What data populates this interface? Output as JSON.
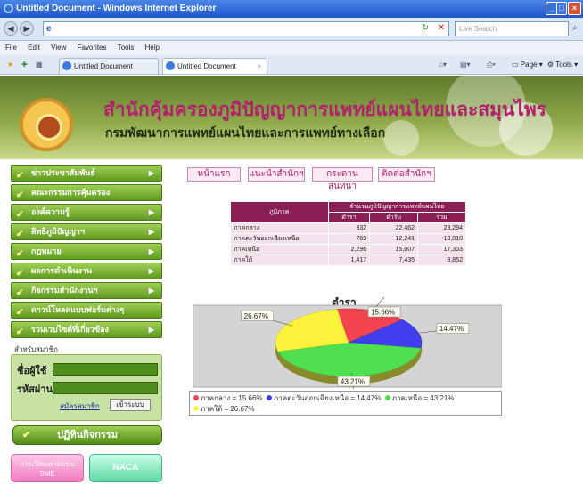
{
  "window": {
    "title": "Untitled Document - Windows Internet Explorer",
    "min": "_",
    "max": "□",
    "close": "×"
  },
  "address": {
    "url": "",
    "search_placeholder": "Live Search"
  },
  "menu": {
    "items": [
      "File",
      "Edit",
      "View",
      "Favorites",
      "Tools",
      "Help"
    ]
  },
  "tabs": [
    {
      "label": "Untitled Document"
    },
    {
      "label": "Untitled Document"
    }
  ],
  "tools": {
    "page": "Page",
    "tools": "Tools"
  },
  "banner": {
    "title": "สำนักคุ้มครองภูมิปัญญาการแพทย์แผนไทยและสมุนไพร",
    "subtitle": "กรมพัฒนาการแพทย์แผนไทยและการแพทย์ทางเลือก"
  },
  "sidebar": {
    "items": [
      {
        "label": "ข่าวประชาสัมพันธ์",
        "arrow": true
      },
      {
        "label": "คณะกรรมการคุ้มครอง",
        "arrow": false
      },
      {
        "label": "องค์ความรู้",
        "arrow": true
      },
      {
        "label": "สิทธิภูมิปัญญาฯ",
        "arrow": true
      },
      {
        "label": "กฎหมาย",
        "arrow": true
      },
      {
        "label": "ผลการดำเนินงาน",
        "arrow": true
      },
      {
        "label": "กิจกรรมสำนักงานฯ",
        "arrow": true
      },
      {
        "label": "ดาวน์โหลดแบบฟอร์มต่างๆ",
        "arrow": false
      },
      {
        "label": "รวมเวบไซต์ที่เกี่ยวข้อง",
        "arrow": true
      }
    ]
  },
  "login": {
    "section_label": "สำหรับสมาชิก",
    "user_label": "ชื่อผู้ใช้",
    "pass_label": "รหัสผ่าน",
    "register": "สมัครสมาชิก",
    "login_btn": "เข้าระบบ"
  },
  "calendar_button": "ปฏิทินกิจกรรม",
  "promo": {
    "pink": "การเปิดตลาดแบบ SME",
    "green": "NACA"
  },
  "nav": {
    "items": [
      "หน้าแรก",
      "แนะนำสำนักฯ",
      "กระดานสนทนา",
      "ติดต่อสำนักฯ"
    ]
  },
  "table": {
    "header_region": "ภูมิภาค",
    "header_group": "จำนวนภูมิปัญญาการแพทย์แผนไทย",
    "columns": [
      "ตำรา",
      "ตำรับ",
      "รวม"
    ],
    "rows": [
      {
        "region": "ภาคกลาง",
        "a": "832",
        "b": "22,462",
        "c": "23,294"
      },
      {
        "region": "ภาคตะวันออกเฉียงเหนือ",
        "a": "769",
        "b": "12,241",
        "c": "13,010"
      },
      {
        "region": "ภาคเหนือ",
        "a": "2,296",
        "b": "15,007",
        "c": "17,303"
      },
      {
        "region": "ภาคใต้",
        "a": "1,417",
        "b": "7,435",
        "c": "8,852"
      }
    ]
  },
  "chart_data": {
    "type": "pie",
    "title": "ตำรา",
    "labels": [
      "ภาคกลาง",
      "ภาคตะวันออกเฉียงเหนือ",
      "ภาคเหนือ",
      "ภาคใต้"
    ],
    "values": [
      15.66,
      14.47,
      43.21,
      26.67
    ],
    "value_labels": [
      "15.66%",
      "14.47%",
      "43.21%",
      "26.67%"
    ],
    "colors": [
      "#f2434e",
      "#3f3ff0",
      "#4fe04f",
      "#fbf23c"
    ],
    "legend_items": [
      "ภาคกลาง = 15.66%",
      "ภาคตะวันออกเฉียงเหนือ = 14.47%",
      "ภาคเหนือ = 43.21%",
      "ภาคใต้ = 26.67%"
    ],
    "legend_position": "bottom"
  }
}
